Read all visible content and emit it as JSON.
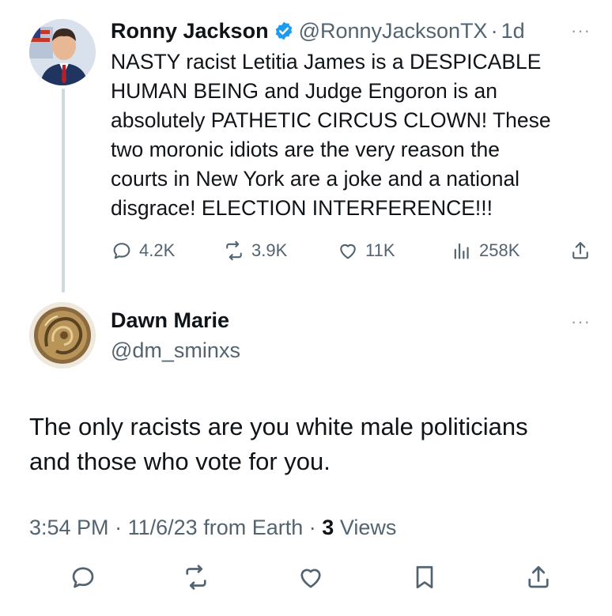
{
  "original_tweet": {
    "author_name": "Ronny Jackson",
    "handle": "@RonnyJacksonTX",
    "separator": "·",
    "age": "1d",
    "more_label": "···",
    "text": "NASTY racist Letitia James is a DESPICABLE\nHUMAN BEING and Judge Engoron is an\nabsolutely PATHETIC CIRCUS CLOWN!  These\ntwo moronic idiots are the very reason the\ncourts in New York are a joke and a national\ndisgrace! ELECTION INTERFERENCE!!!",
    "stats": {
      "replies": "4.2K",
      "reposts": "3.9K",
      "likes": "11K",
      "views": "258K"
    }
  },
  "reply_tweet": {
    "author_name": "Dawn Marie",
    "handle": "@dm_sminxs",
    "more_label": "···",
    "text": "The only racists are you white male politicians\nand those who vote for you.",
    "time": "3:54 PM",
    "separator": "·",
    "date": "11/6/23",
    "source": "from Earth",
    "views_count": "3",
    "views_label": "Views"
  },
  "icons": {
    "verified": "verified-badge-icon",
    "reply": "reply-icon",
    "repost": "repost-icon",
    "like": "heart-icon",
    "views": "analytics-icon",
    "share": "share-icon",
    "bookmark": "bookmark-icon"
  },
  "colors": {
    "verified_blue": "#1d9bf0",
    "text": "#0f1419",
    "muted": "#536471",
    "thread_line": "#cfd9de"
  }
}
